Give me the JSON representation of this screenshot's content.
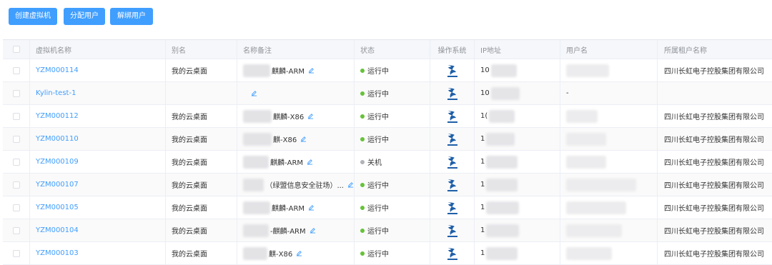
{
  "toolbar": {
    "create_label": "创建虚拟机",
    "assign_label": "分配用户",
    "unbind_label": "解绑用户"
  },
  "columns": {
    "name": "虚拟机名称",
    "alias": "别名",
    "remark": "名称备注",
    "status": "状态",
    "os": "操作系统",
    "ip": "IP地址",
    "user": "用户名",
    "tenant": "所属租户名称"
  },
  "colors": {
    "accent": "#409eff",
    "running": "#67c23a",
    "stopped": "#b0b3b8"
  },
  "rows": [
    {
      "name": "YZM000114",
      "alias": "我的云桌面",
      "remark": "麒麟-ARM",
      "status": "运行中",
      "status_color": "#67c23a",
      "ip": "10",
      "user": "",
      "tenant": "四川长虹电子控股集团有限公司"
    },
    {
      "name": "Kylin-test-1",
      "alias": "",
      "remark": "",
      "status": "运行中",
      "status_color": "#67c23a",
      "ip": "10",
      "user": "-",
      "tenant": ""
    },
    {
      "name": "YZM000112",
      "alias": "我的云桌面",
      "remark": "麒麟-X86",
      "status": "运行中",
      "status_color": "#67c23a",
      "ip": "1(",
      "user": "",
      "tenant": "四川长虹电子控股集团有限公司"
    },
    {
      "name": "YZM000110",
      "alias": "我的云桌面",
      "remark": "麒-X86",
      "status": "运行中",
      "status_color": "#67c23a",
      "ip": "1",
      "user": "",
      "tenant": "四川长虹电子控股集团有限公司"
    },
    {
      "name": "YZM000109",
      "alias": "我的云桌面",
      "remark": "麒麟-ARM",
      "status": "关机",
      "status_color": "#b0b3b8",
      "ip": "1",
      "user": "",
      "tenant": "四川长虹电子控股集团有限公司"
    },
    {
      "name": "YZM000107",
      "alias": "我的云桌面",
      "remark": "（绿盟信息安全驻场）...",
      "status": "运行中",
      "status_color": "#67c23a",
      "ip": "1",
      "user": "",
      "tenant": "四川长虹电子控股集团有限公司"
    },
    {
      "name": "YZM000105",
      "alias": "我的云桌面",
      "remark": "麒麟-ARM",
      "status": "运行中",
      "status_color": "#67c23a",
      "ip": "1",
      "user": "",
      "tenant": "四川长虹电子控股集团有限公司"
    },
    {
      "name": "YZM000104",
      "alias": "我的云桌面",
      "remark": "-麒麟-ARM",
      "status": "运行中",
      "status_color": "#67c23a",
      "ip": "1",
      "user": "",
      "tenant": "四川长虹电子控股集团有限公司"
    },
    {
      "name": "YZM000103",
      "alias": "我的云桌面",
      "remark": "麒-X86",
      "status": "运行中",
      "status_color": "#67c23a",
      "ip": "1",
      "user": "",
      "tenant": "四川长虹电子控股集团有限公司"
    }
  ]
}
